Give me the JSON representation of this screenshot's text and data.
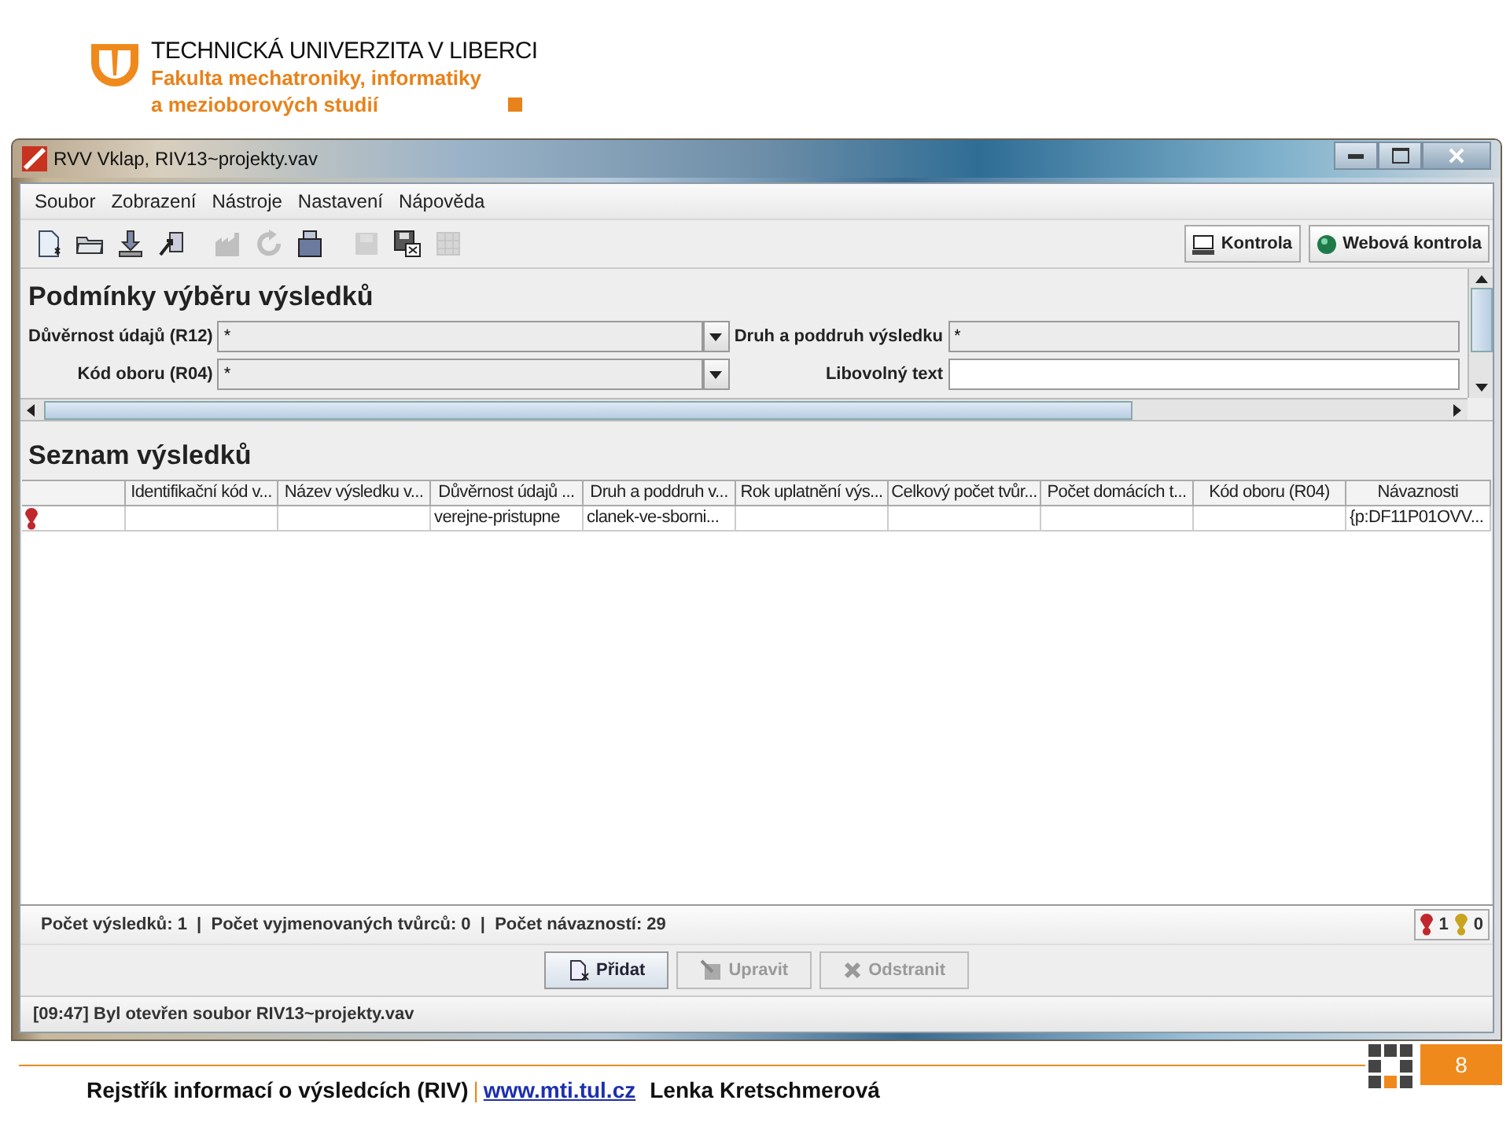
{
  "header": {
    "university": "TECHNICKÁ UNIVERZITA V LIBERCI",
    "faculty_line_1": "Fakulta mechatroniky, informatiky",
    "faculty_line_2": "a mezioborových studií"
  },
  "window": {
    "title": "RVV Vklap, RIV13~projekty.vav"
  },
  "menu": [
    "Soubor",
    "Zobrazení",
    "Nástroje",
    "Nastavení",
    "Nápověda"
  ],
  "toolbar": [
    {
      "kind": "new",
      "disabled": false
    },
    {
      "kind": "open",
      "disabled": false
    },
    {
      "kind": "import",
      "disabled": false
    },
    {
      "kind": "export",
      "disabled": false
    },
    {
      "kind": "factory",
      "disabled": true
    },
    {
      "kind": "refresh",
      "disabled": true
    },
    {
      "kind": "box",
      "disabled": false
    },
    {
      "kind": "save",
      "disabled": true
    },
    {
      "kind": "save_as",
      "disabled": false
    },
    {
      "kind": "grid",
      "disabled": true
    }
  ],
  "toolbar_buttons": [
    {
      "kind": "monitor",
      "label": "Kontrola"
    },
    {
      "kind": "globe",
      "label": "Webová kontrola"
    }
  ],
  "filter": {
    "title": "Podmínky výběru výsledků",
    "fields": [
      {
        "label": "Důvěrnost údajů (R12)",
        "kind": "combo",
        "value": "*"
      },
      {
        "label": "Druh a poddruh výsledku",
        "kind": "text",
        "value": "*"
      },
      {
        "label": "Kód oboru (R04)",
        "kind": "combo",
        "value": "*"
      },
      {
        "label": "Libovolný text",
        "kind": "text"
      }
    ]
  },
  "results": {
    "title": "Seznam výsledků",
    "columns": [
      "Identifikační kód v...",
      "Název výsledku v...",
      "Důvěrnost údajů ...",
      "Druh a poddruh v...",
      "Rok uplatnění výs...",
      "Celkový počet tvůr...",
      "Počet domácích t...",
      "Kód oboru (R04)",
      "Návaznosti"
    ],
    "rows": [
      {
        "color": "#c0282d",
        "cells": [
          null,
          null,
          "verejne-pristupne",
          "clanek-ve-sborni...",
          null,
          null,
          null,
          null,
          "{p:DF11P01OVV..."
        ]
      }
    ]
  },
  "status": {
    "text": "Počet výsledků: 1  |  Počet vyjmenovaných tvůrců: 0  |  Počet návazností: 29",
    "counters": [
      {
        "color": "#c0282d",
        "count": "1"
      },
      {
        "color": "#c9a41c",
        "count": "0"
      }
    ]
  },
  "actions": [
    {
      "kind": "add",
      "label": "Přidat",
      "disabled": false
    },
    {
      "kind": "edit",
      "label": "Upravit",
      "disabled": true
    },
    {
      "kind": "delete",
      "label": "Odstranit",
      "disabled": true
    }
  ],
  "message": "[09:47] Byl otevřen soubor RIV13~projekty.vav",
  "footer": {
    "title": "Rejstřík informací o výsledcích (RIV)",
    "separator": "|",
    "link": "www.mti.tul.cz",
    "author": "Lenka Kretschmerová",
    "page": "8"
  }
}
